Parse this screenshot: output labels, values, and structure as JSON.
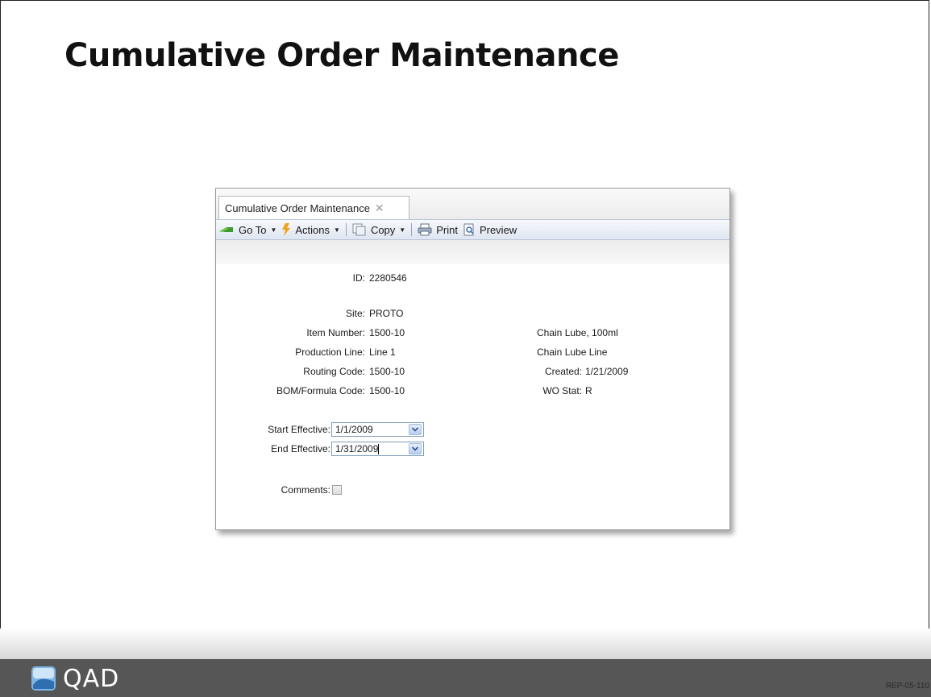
{
  "slide": {
    "title": "Cumulative Order Maintenance",
    "footer_logo_text": "QAD",
    "slide_code": "REP-05-110"
  },
  "window": {
    "tab_label": "Cumulative Order Maintenance",
    "tab_close_icon": "close-icon",
    "toolbar": {
      "goto_label": "Go To",
      "actions_label": "Actions",
      "copy_label": "Copy",
      "print_label": "Print",
      "preview_label": "Preview"
    }
  },
  "form": {
    "id_label": "ID:",
    "id_value": "2280546",
    "site_label": "Site:",
    "site_value": "PROTO",
    "item_label": "Item Number:",
    "item_value": "1500-10",
    "item_desc": "Chain Lube, 100ml",
    "prodline_label": "Production Line:",
    "prodline_value": "Line 1",
    "prodline_desc": "Chain Lube Line",
    "routing_label": "Routing Code:",
    "routing_value": "1500-10",
    "created_label": "Created:",
    "created_value": "1/21/2009",
    "bom_label": "BOM/Formula Code:",
    "bom_value": "1500-10",
    "wostat_label": "WO Stat:",
    "wostat_value": "R",
    "start_label": "Start Effective:",
    "start_value": "1/1/2009",
    "end_label": "End Effective:",
    "end_value": "1/31/2009",
    "comments_label": "Comments:",
    "comments_checked": false
  }
}
